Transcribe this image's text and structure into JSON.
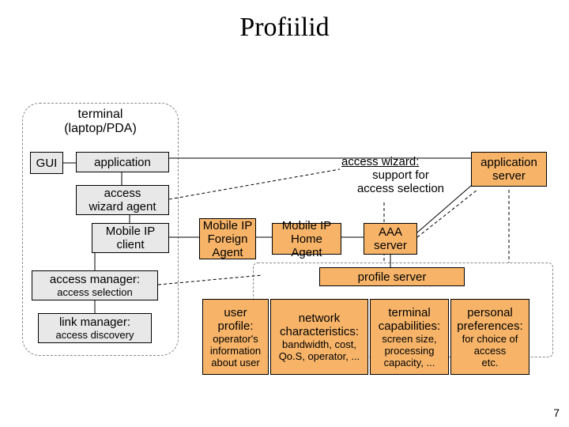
{
  "title": "Profiilid",
  "terminal": {
    "label_line1": "terminal",
    "label_line2": "(laptop/PDA)"
  },
  "boxes": {
    "gui": "GUI",
    "application": "application",
    "access_wizard_agent": "access\nwizard agent",
    "mobile_ip_client": "Mobile IP\nclient",
    "access_manager_title": "access manager:",
    "access_manager_sub": "access selection",
    "link_manager_title": "link manager:",
    "link_manager_sub": "access discovery",
    "mip_foreign_agent": "Mobile IP\nForeign\nAgent",
    "mip_home_agent": "Mobile IP\nHome Agent",
    "aaa_server": "AAA\nserver",
    "application_server": "application\nserver",
    "profile_server": "profile server",
    "user_profile_title": "user\nprofile:",
    "user_profile_sub": "operator's\ninformation\nabout user",
    "net_char_title": "network\ncharacteristics:",
    "net_char_sub": "bandwidth, cost,\nQo.S, operator, ...",
    "term_cap_title": "terminal\ncapabilities:",
    "term_cap_sub": "screen size,\nprocessing\ncapacity, ...",
    "pers_pref_title": "personal\npreferences:",
    "pers_pref_sub": "for choice of\naccess\netc."
  },
  "wizard_note": {
    "title": "access wizard:",
    "sub": "support for\naccess selection"
  },
  "page_number": "7"
}
